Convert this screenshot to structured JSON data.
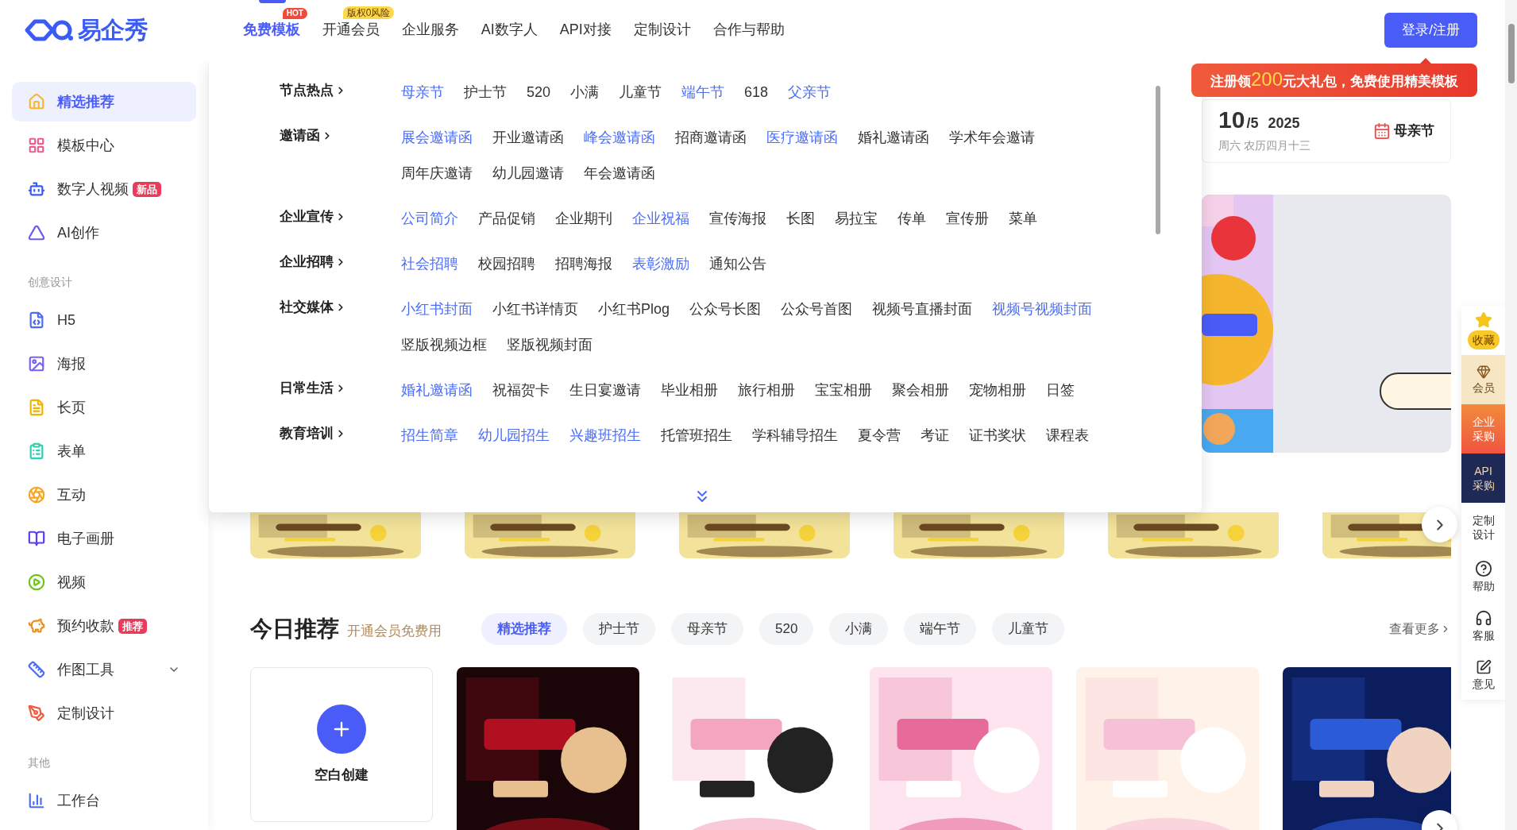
{
  "header": {
    "logo": "易企秀",
    "nav": [
      {
        "label": "免费模板",
        "selected": true,
        "badge": {
          "kind": "hot",
          "label": "HOT"
        }
      },
      {
        "label": "开通会员",
        "selected": false,
        "badge": {
          "kind": "tag",
          "label": "版权0风险"
        }
      },
      {
        "label": "企业服务",
        "selected": false
      },
      {
        "label": "AI数字人",
        "selected": false
      },
      {
        "label": "API对接",
        "selected": false
      },
      {
        "label": "定制设计",
        "selected": false
      },
      {
        "label": "合作与帮助",
        "selected": false
      }
    ],
    "login_button": "登录/注册"
  },
  "promo": "注册领**200**元大礼包，免费使用精美模板",
  "sidebar": {
    "items": [
      {
        "kind": "item",
        "label": "精选推荐",
        "selected": true
      },
      {
        "kind": "item",
        "label": "模板中心",
        "selected": false
      },
      {
        "kind": "item",
        "label": "数字人视频",
        "selected": false,
        "badge": "新品"
      },
      {
        "kind": "item",
        "label": "AI创作",
        "selected": false
      },
      {
        "kind": "header",
        "label": "创意设计"
      },
      {
        "kind": "item",
        "label": "H5",
        "selected": false
      },
      {
        "kind": "item",
        "label": "海报",
        "selected": false
      },
      {
        "kind": "item",
        "label": "长页",
        "selected": false
      },
      {
        "kind": "item",
        "label": "表单",
        "selected": false
      },
      {
        "kind": "item",
        "label": "互动",
        "selected": false
      },
      {
        "kind": "item",
        "label": "电子画册",
        "selected": false
      },
      {
        "kind": "item",
        "label": "视频",
        "selected": false
      },
      {
        "kind": "item",
        "label": "预约收款",
        "selected": false,
        "badge": "推荐"
      },
      {
        "kind": "item",
        "label": "作图工具",
        "selected": false,
        "expanded": false
      },
      {
        "kind": "item",
        "label": "定制设计",
        "selected": false
      },
      {
        "kind": "header",
        "label": "其他"
      },
      {
        "kind": "item",
        "label": "工作台",
        "selected": false
      }
    ]
  },
  "menu": {
    "categories": [
      {
        "label": "节点热点",
        "rows": [
          [
            {
              "label": "母亲节",
              "highlighted": true
            },
            {
              "label": "护士节",
              "highlighted": false
            },
            {
              "label": "520",
              "highlighted": false
            },
            {
              "label": "小满",
              "highlighted": false
            },
            {
              "label": "儿童节",
              "highlighted": false
            },
            {
              "label": "端午节",
              "highlighted": true
            },
            {
              "label": "618",
              "highlighted": false
            },
            {
              "label": "父亲节",
              "highlighted": true
            }
          ]
        ]
      },
      {
        "label": "邀请函",
        "rows": [
          [
            {
              "label": "展会邀请函",
              "highlighted": true
            },
            {
              "label": "开业邀请函",
              "highlighted": false
            },
            {
              "label": "峰会邀请函",
              "highlighted": true
            },
            {
              "label": "招商邀请函",
              "highlighted": false
            },
            {
              "label": "医疗邀请函",
              "highlighted": true
            },
            {
              "label": "婚礼邀请函",
              "highlighted": false
            },
            {
              "label": "学术年会邀请",
              "highlighted": false
            }
          ],
          [
            {
              "label": "周年庆邀请",
              "highlighted": false
            },
            {
              "label": "幼儿园邀请",
              "highlighted": false
            },
            {
              "label": "年会邀请函",
              "highlighted": false
            }
          ]
        ]
      },
      {
        "label": "企业宣传",
        "rows": [
          [
            {
              "label": "公司简介",
              "highlighted": true
            },
            {
              "label": "产品促销",
              "highlighted": false
            },
            {
              "label": "企业期刊",
              "highlighted": false
            },
            {
              "label": "企业祝福",
              "highlighted": true
            },
            {
              "label": "宣传海报",
              "highlighted": false
            },
            {
              "label": "长图",
              "highlighted": false
            },
            {
              "label": "易拉宝",
              "highlighted": false
            },
            {
              "label": "传单",
              "highlighted": false
            },
            {
              "label": "宣传册",
              "highlighted": false
            },
            {
              "label": "菜单",
              "highlighted": false
            }
          ]
        ]
      },
      {
        "label": "企业招聘",
        "rows": [
          [
            {
              "label": "社会招聘",
              "highlighted": true
            },
            {
              "label": "校园招聘",
              "highlighted": false
            },
            {
              "label": "招聘海报",
              "highlighted": false
            },
            {
              "label": "表彰激励",
              "highlighted": true
            },
            {
              "label": "通知公告",
              "highlighted": false
            }
          ]
        ]
      },
      {
        "label": "社交媒体",
        "rows": [
          [
            {
              "label": "小红书封面",
              "highlighted": true
            },
            {
              "label": "小红书详情页",
              "highlighted": false
            },
            {
              "label": "小红书Plog",
              "highlighted": false
            },
            {
              "label": "公众号长图",
              "highlighted": false
            },
            {
              "label": "公众号首图",
              "highlighted": false
            },
            {
              "label": "视频号直播封面",
              "highlighted": false
            },
            {
              "label": "视频号视频封面",
              "highlighted": true
            }
          ],
          [
            {
              "label": "竖版视频边框",
              "highlighted": false
            },
            {
              "label": "竖版视频封面",
              "highlighted": false
            }
          ]
        ]
      },
      {
        "label": "日常生活",
        "rows": [
          [
            {
              "label": "婚礼邀请函",
              "highlighted": true
            },
            {
              "label": "祝福贺卡",
              "highlighted": false
            },
            {
              "label": "生日宴邀请",
              "highlighted": false
            },
            {
              "label": "毕业相册",
              "highlighted": false
            },
            {
              "label": "旅行相册",
              "highlighted": false
            },
            {
              "label": "宝宝相册",
              "highlighted": false
            },
            {
              "label": "聚会相册",
              "highlighted": false
            },
            {
              "label": "宠物相册",
              "highlighted": false
            },
            {
              "label": "日签",
              "highlighted": false
            }
          ]
        ]
      },
      {
        "label": "教育培训",
        "rows": [
          [
            {
              "label": "招生简章",
              "highlighted": true
            },
            {
              "label": "幼儿园招生",
              "highlighted": true
            },
            {
              "label": "兴趣班招生",
              "highlighted": true
            },
            {
              "label": "托管班招生",
              "highlighted": false
            },
            {
              "label": "学科辅导招生",
              "highlighted": false
            },
            {
              "label": "夏令营",
              "highlighted": false
            },
            {
              "label": "考证",
              "highlighted": false
            },
            {
              "label": "证书奖状",
              "highlighted": false
            },
            {
              "label": "课程表",
              "highlighted": false
            }
          ]
        ]
      }
    ]
  },
  "date_card": {
    "day": "10",
    "month": "/5",
    "year": "2025",
    "lunar": "周六 农历四月十三",
    "festival": "母亲节"
  },
  "side_toolbar": [
    {
      "kind": "star",
      "label": "收藏"
    },
    {
      "kind": "vip",
      "label": "会员"
    },
    {
      "kind": "orange",
      "label": "企业采购"
    },
    {
      "kind": "navy",
      "label": "API采购"
    },
    {
      "kind": "plain",
      "label": "定制设计"
    },
    {
      "kind": "help",
      "label": "帮助"
    },
    {
      "kind": "service",
      "label": "客服"
    },
    {
      "kind": "feedback",
      "label": "意见"
    }
  ],
  "today": {
    "title": "今日推荐",
    "subtitle": "开通会员免费用",
    "chips": [
      {
        "label": "精选推荐",
        "selected": true
      },
      {
        "label": "护士节",
        "selected": false
      },
      {
        "label": "母亲节",
        "selected": false
      },
      {
        "label": "520",
        "selected": false
      },
      {
        "label": "小满",
        "selected": false
      },
      {
        "label": "端午节",
        "selected": false
      },
      {
        "label": "儿童节",
        "selected": false
      }
    ],
    "more": "查看更多",
    "blank_card": "空白创建"
  }
}
